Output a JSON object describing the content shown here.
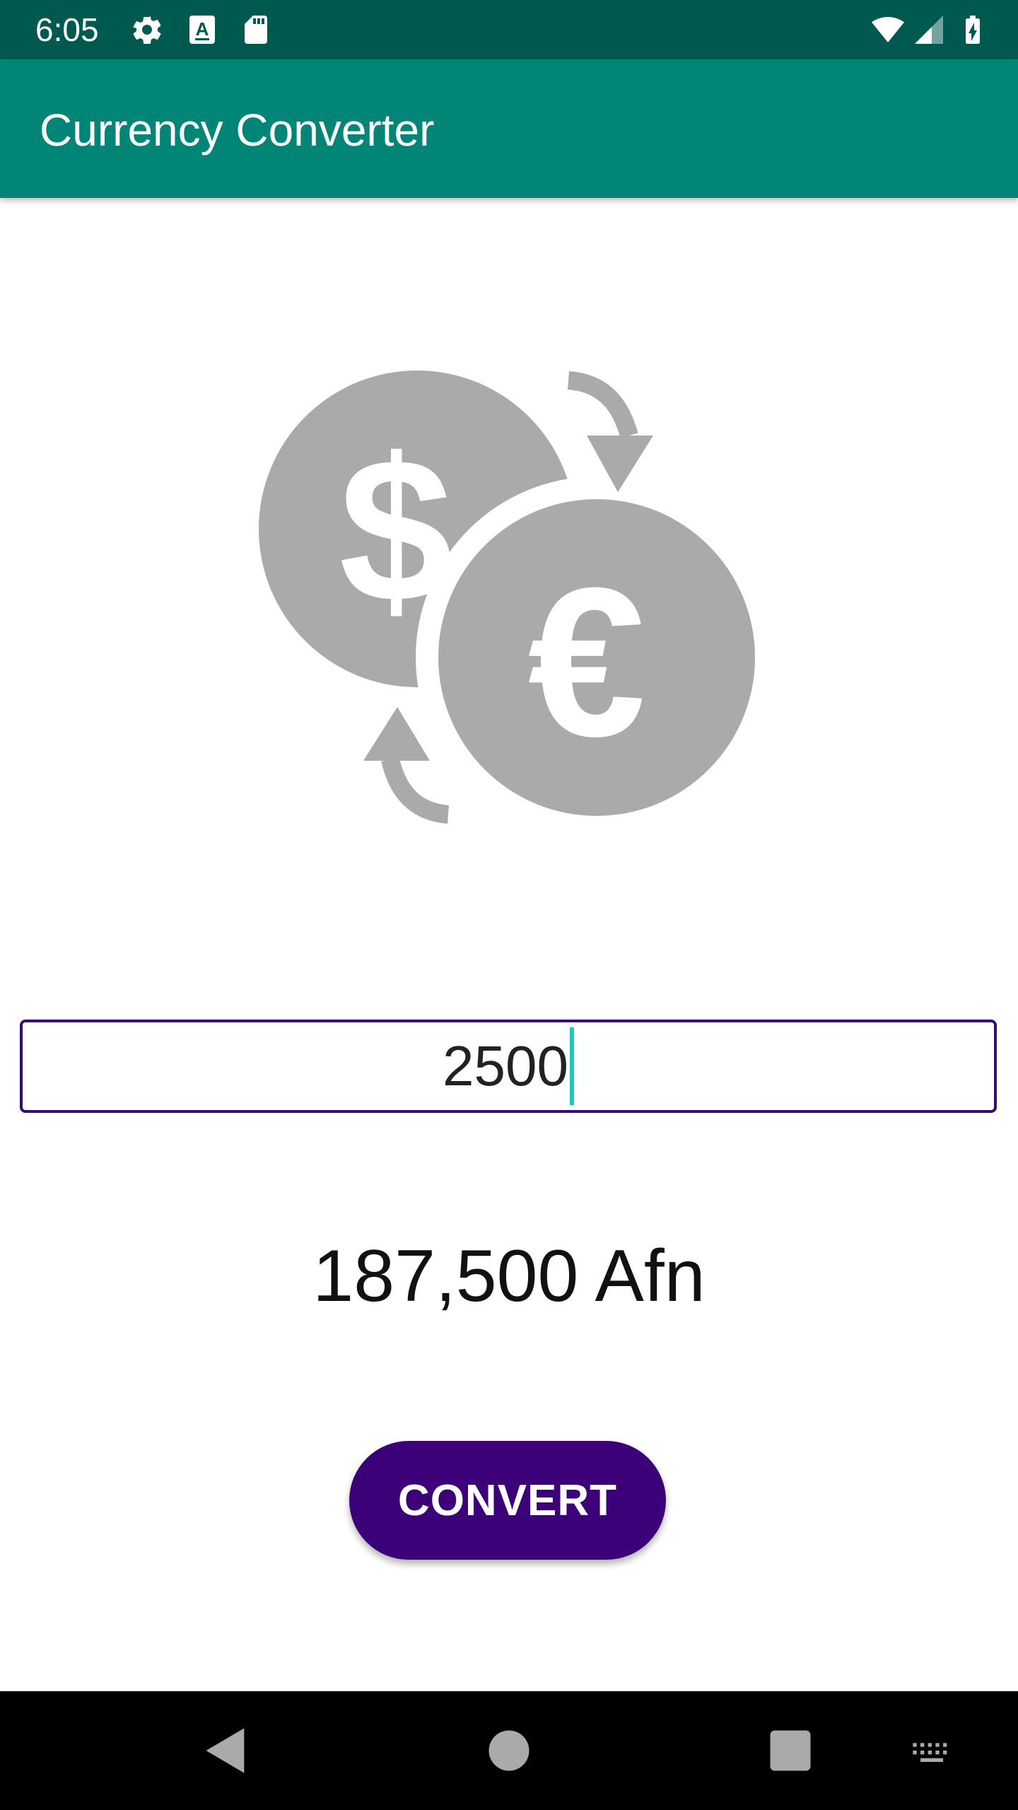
{
  "status_bar": {
    "time": "6:05",
    "icons_left": [
      "settings-icon",
      "keyboard-a-icon",
      "sd-card-icon"
    ],
    "icons_right": [
      "wifi-icon",
      "cell-signal-icon",
      "battery-charging-icon"
    ]
  },
  "app_bar": {
    "title": "Currency Converter",
    "color": "#008577"
  },
  "hero": {
    "icon": "currency-exchange-dollar-euro-icon",
    "color": "#aaaaaa"
  },
  "input": {
    "value": "2500"
  },
  "result": {
    "text": "187,500 Afn"
  },
  "convert_button": {
    "label": "CONVERT",
    "color": "#3c0078"
  },
  "nav_bar": {
    "buttons": [
      "back-icon",
      "home-icon",
      "recents-icon",
      "keyboard-icon"
    ]
  }
}
